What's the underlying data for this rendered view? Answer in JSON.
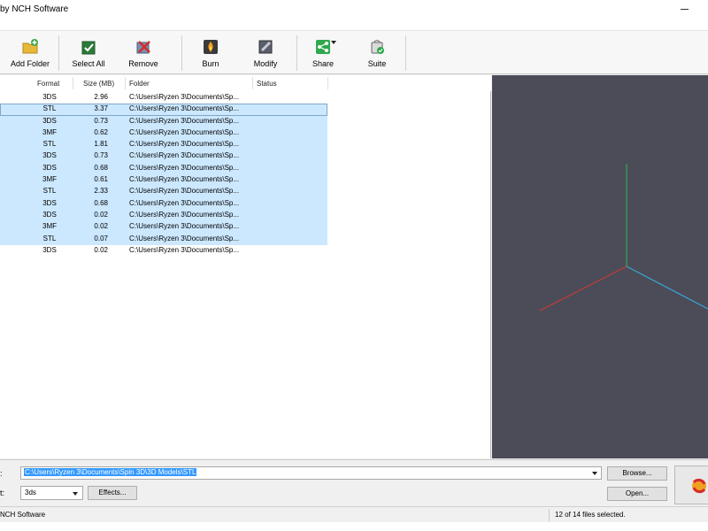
{
  "window": {
    "title": "by NCH Software"
  },
  "toolbar": {
    "add_folder": "Add Folder",
    "select_all": "Select All",
    "remove": "Remove",
    "burn": "Burn",
    "modify": "Modify",
    "share": "Share",
    "suite": "Suite"
  },
  "list": {
    "columns": {
      "format": "Format",
      "size": "Size (MB)",
      "folder": "Folder",
      "status": "Status"
    },
    "rows": [
      {
        "format": "3DS",
        "size": "2.96",
        "folder": "C:\\Users\\Ryzen 3\\Documents\\Sp...",
        "selected": false,
        "focused": false
      },
      {
        "format": "STL",
        "size": "3.37",
        "folder": "C:\\Users\\Ryzen 3\\Documents\\Sp...",
        "selected": true,
        "focused": true
      },
      {
        "format": "3DS",
        "size": "0.73",
        "folder": "C:\\Users\\Ryzen 3\\Documents\\Sp...",
        "selected": true,
        "focused": false
      },
      {
        "format": "3MF",
        "size": "0.62",
        "folder": "C:\\Users\\Ryzen 3\\Documents\\Sp...",
        "selected": true,
        "focused": false
      },
      {
        "format": "STL",
        "size": "1.81",
        "folder": "C:\\Users\\Ryzen 3\\Documents\\Sp...",
        "selected": true,
        "focused": false
      },
      {
        "format": "3DS",
        "size": "0.73",
        "folder": "C:\\Users\\Ryzen 3\\Documents\\Sp...",
        "selected": true,
        "focused": false
      },
      {
        "format": "3DS",
        "size": "0.68",
        "folder": "C:\\Users\\Ryzen 3\\Documents\\Sp...",
        "selected": true,
        "focused": false
      },
      {
        "format": "3MF",
        "size": "0.61",
        "folder": "C:\\Users\\Ryzen 3\\Documents\\Sp...",
        "selected": true,
        "focused": false
      },
      {
        "format": "STL",
        "size": "2.33",
        "folder": "C:\\Users\\Ryzen 3\\Documents\\Sp...",
        "selected": true,
        "focused": false
      },
      {
        "format": "3DS",
        "size": "0.68",
        "folder": "C:\\Users\\Ryzen 3\\Documents\\Sp...",
        "selected": true,
        "focused": false
      },
      {
        "format": "3DS",
        "size": "0.02",
        "folder": "C:\\Users\\Ryzen 3\\Documents\\Sp...",
        "selected": true,
        "focused": false
      },
      {
        "format": "3MF",
        "size": "0.02",
        "folder": "C:\\Users\\Ryzen 3\\Documents\\Sp...",
        "selected": true,
        "focused": false
      },
      {
        "format": "STL",
        "size": "0.07",
        "folder": "C:\\Users\\Ryzen 3\\Documents\\Sp...",
        "selected": true,
        "focused": false
      },
      {
        "format": "3DS",
        "size": "0.02",
        "folder": "C:\\Users\\Ryzen 3\\Documents\\Sp...",
        "selected": false,
        "focused": false
      }
    ]
  },
  "output": {
    "folder_label": ":",
    "format_label": "t:",
    "folder_path": "C:\\Users\\Ryzen 3\\Documents\\Spin 3D\\3D Models\\STL",
    "format_value": "3ds",
    "effects_label": "Effects...",
    "browse_label": "Browse...",
    "open_label": "Open..."
  },
  "status": {
    "left": "NCH Software",
    "right": "12 of 14 files selected."
  },
  "colors": {
    "selection": "#cce8ff",
    "preview_background": "#4b4c58",
    "axis_x": "#c43c3c",
    "axis_y": "#2fa84f",
    "axis_z": "#3aa7d6"
  }
}
